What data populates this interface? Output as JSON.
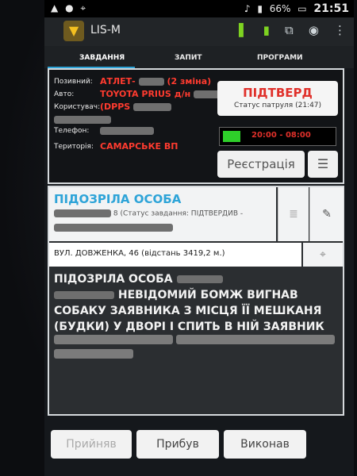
{
  "statusbar": {
    "battery": "66%",
    "time": "21:51"
  },
  "actionbar": {
    "app_title": "LIS-M",
    "icons": [
      "signal-bars-icon",
      "battery-charging-icon",
      "screen-capture-icon",
      "eye-icon",
      "overflow-menu-icon"
    ]
  },
  "tabs": [
    {
      "label": "ЗАВДАННЯ"
    },
    {
      "label": "ЗАПИТ"
    },
    {
      "label": "ПРОГРАМИ"
    }
  ],
  "info": {
    "labels": {
      "callsign": "Позивний:",
      "auto": "Авто:",
      "user": "Користувач:",
      "phone": "Телефон:",
      "territory": "Територія:"
    },
    "callsign_value": "АТЛЕТ-",
    "callsign_shift": "(2 зміна)",
    "auto_value": "TOYOTA PRIUS д/н",
    "user_value": "(DPPS",
    "territory_value": "САМАРСЬКЕ ВП"
  },
  "status": {
    "title": "ПІДТВЕРД",
    "subtitle": "Статус патруля (21:47)"
  },
  "shift": {
    "time_range": "20:00 - 08:00"
  },
  "buttons": {
    "registration": "Реєстрація",
    "accepted": "Прийняв",
    "arrived": "Прибув",
    "completed": "Виконав"
  },
  "task": {
    "type": "ПІДОЗРІЛА ОСОБА",
    "status_line": "8 (Статус завдання: ПІДТВЕРДИВ -",
    "address": "ВУЛ. ДОВЖЕНКА, 46 (відстань 3419,2 м.)",
    "description_lines": [
      "ПІДОЗРІЛА ОСОБА",
      "НЕВІДОМИЙ БОМЖ ВИГНАВ",
      "СОБАКУ ЗАЯВНИКА З МІСЦЯ ЇЇ МЕШКАНЯ",
      "(БУДКИ) У ДВОРІ І СПИТЬ В НІЙ Заявник"
    ]
  }
}
